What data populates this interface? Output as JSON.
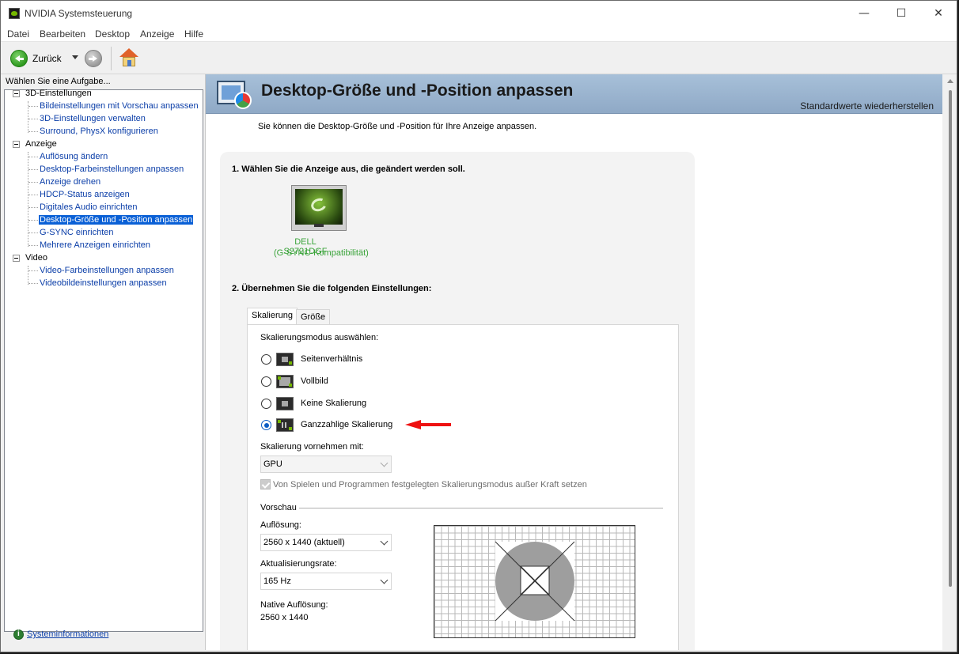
{
  "window": {
    "title": "NVIDIA Systemsteuerung",
    "controls": {
      "minimize": "—",
      "maximize": "☐",
      "close": "✕"
    }
  },
  "menu": [
    "Datei",
    "Bearbeiten",
    "Desktop",
    "Anzeige",
    "Hilfe"
  ],
  "toolbar": {
    "back_label": "Zurück"
  },
  "sidebar": {
    "header": "Wählen Sie eine Aufgabe...",
    "groups": [
      {
        "label": "3D-Einstellungen",
        "items": [
          "Bildeinstellungen mit Vorschau anpassen",
          "3D-Einstellungen verwalten",
          "Surround, PhysX konfigurieren"
        ]
      },
      {
        "label": "Anzeige",
        "items": [
          "Auflösung ändern",
          "Desktop-Farbeinstellungen anpassen",
          "Anzeige drehen",
          "HDCP-Status anzeigen",
          "Digitales Audio einrichten",
          "Desktop-Größe und -Position anpassen",
          "G-SYNC einrichten",
          "Mehrere Anzeigen einrichten"
        ]
      },
      {
        "label": "Video",
        "items": [
          "Video-Farbeinstellungen anpassen",
          "Videobildeinstellungen anpassen"
        ]
      }
    ],
    "selected": "Desktop-Größe und -Position anpassen",
    "footer_link": "Systeminformationen"
  },
  "main": {
    "title": "Desktop-Größe und -Position anpassen",
    "restore_defaults": "Standardwerte wiederherstellen",
    "description": "Sie können die Desktop-Größe und -Position für Ihre Anzeige anpassen.",
    "step1": "1. Wählen Sie die Anzeige aus, die geändert werden soll.",
    "display_name": "DELL S2721DGF",
    "display_sub": "(G-SYNC-Kompatibilität)",
    "step2": "2. Übernehmen Sie die folgenden Einstellungen:",
    "tabs": [
      "Skalierung",
      "Größe"
    ],
    "scaling_mode_label": "Skalierungsmodus auswählen:",
    "scaling_modes": [
      {
        "label": "Seitenverhältnis",
        "checked": false
      },
      {
        "label": "Vollbild",
        "checked": false
      },
      {
        "label": "Keine Skalierung",
        "checked": false
      },
      {
        "label": "Ganzzahlige Skalierung",
        "checked": true
      }
    ],
    "perform_on_label": "Skalierung vornehmen mit:",
    "perform_on_value": "GPU",
    "override_label": "Von Spielen und Programmen festgelegten Skalierungsmodus außer Kraft setzen",
    "preview_label": "Vorschau",
    "resolution_label": "Auflösung:",
    "resolution_value": "2560 x 1440 (aktuell)",
    "refresh_label": "Aktualisierungsrate:",
    "refresh_value": "165 Hz",
    "native_label": "Native Auflösung:",
    "native_value": "2560 x 1440"
  },
  "colors": {
    "accent": "#76b900",
    "link": "#0b3ea8",
    "selection": "#0a60d6",
    "banner": "#a7c0d9",
    "arrow": "#e11111"
  }
}
